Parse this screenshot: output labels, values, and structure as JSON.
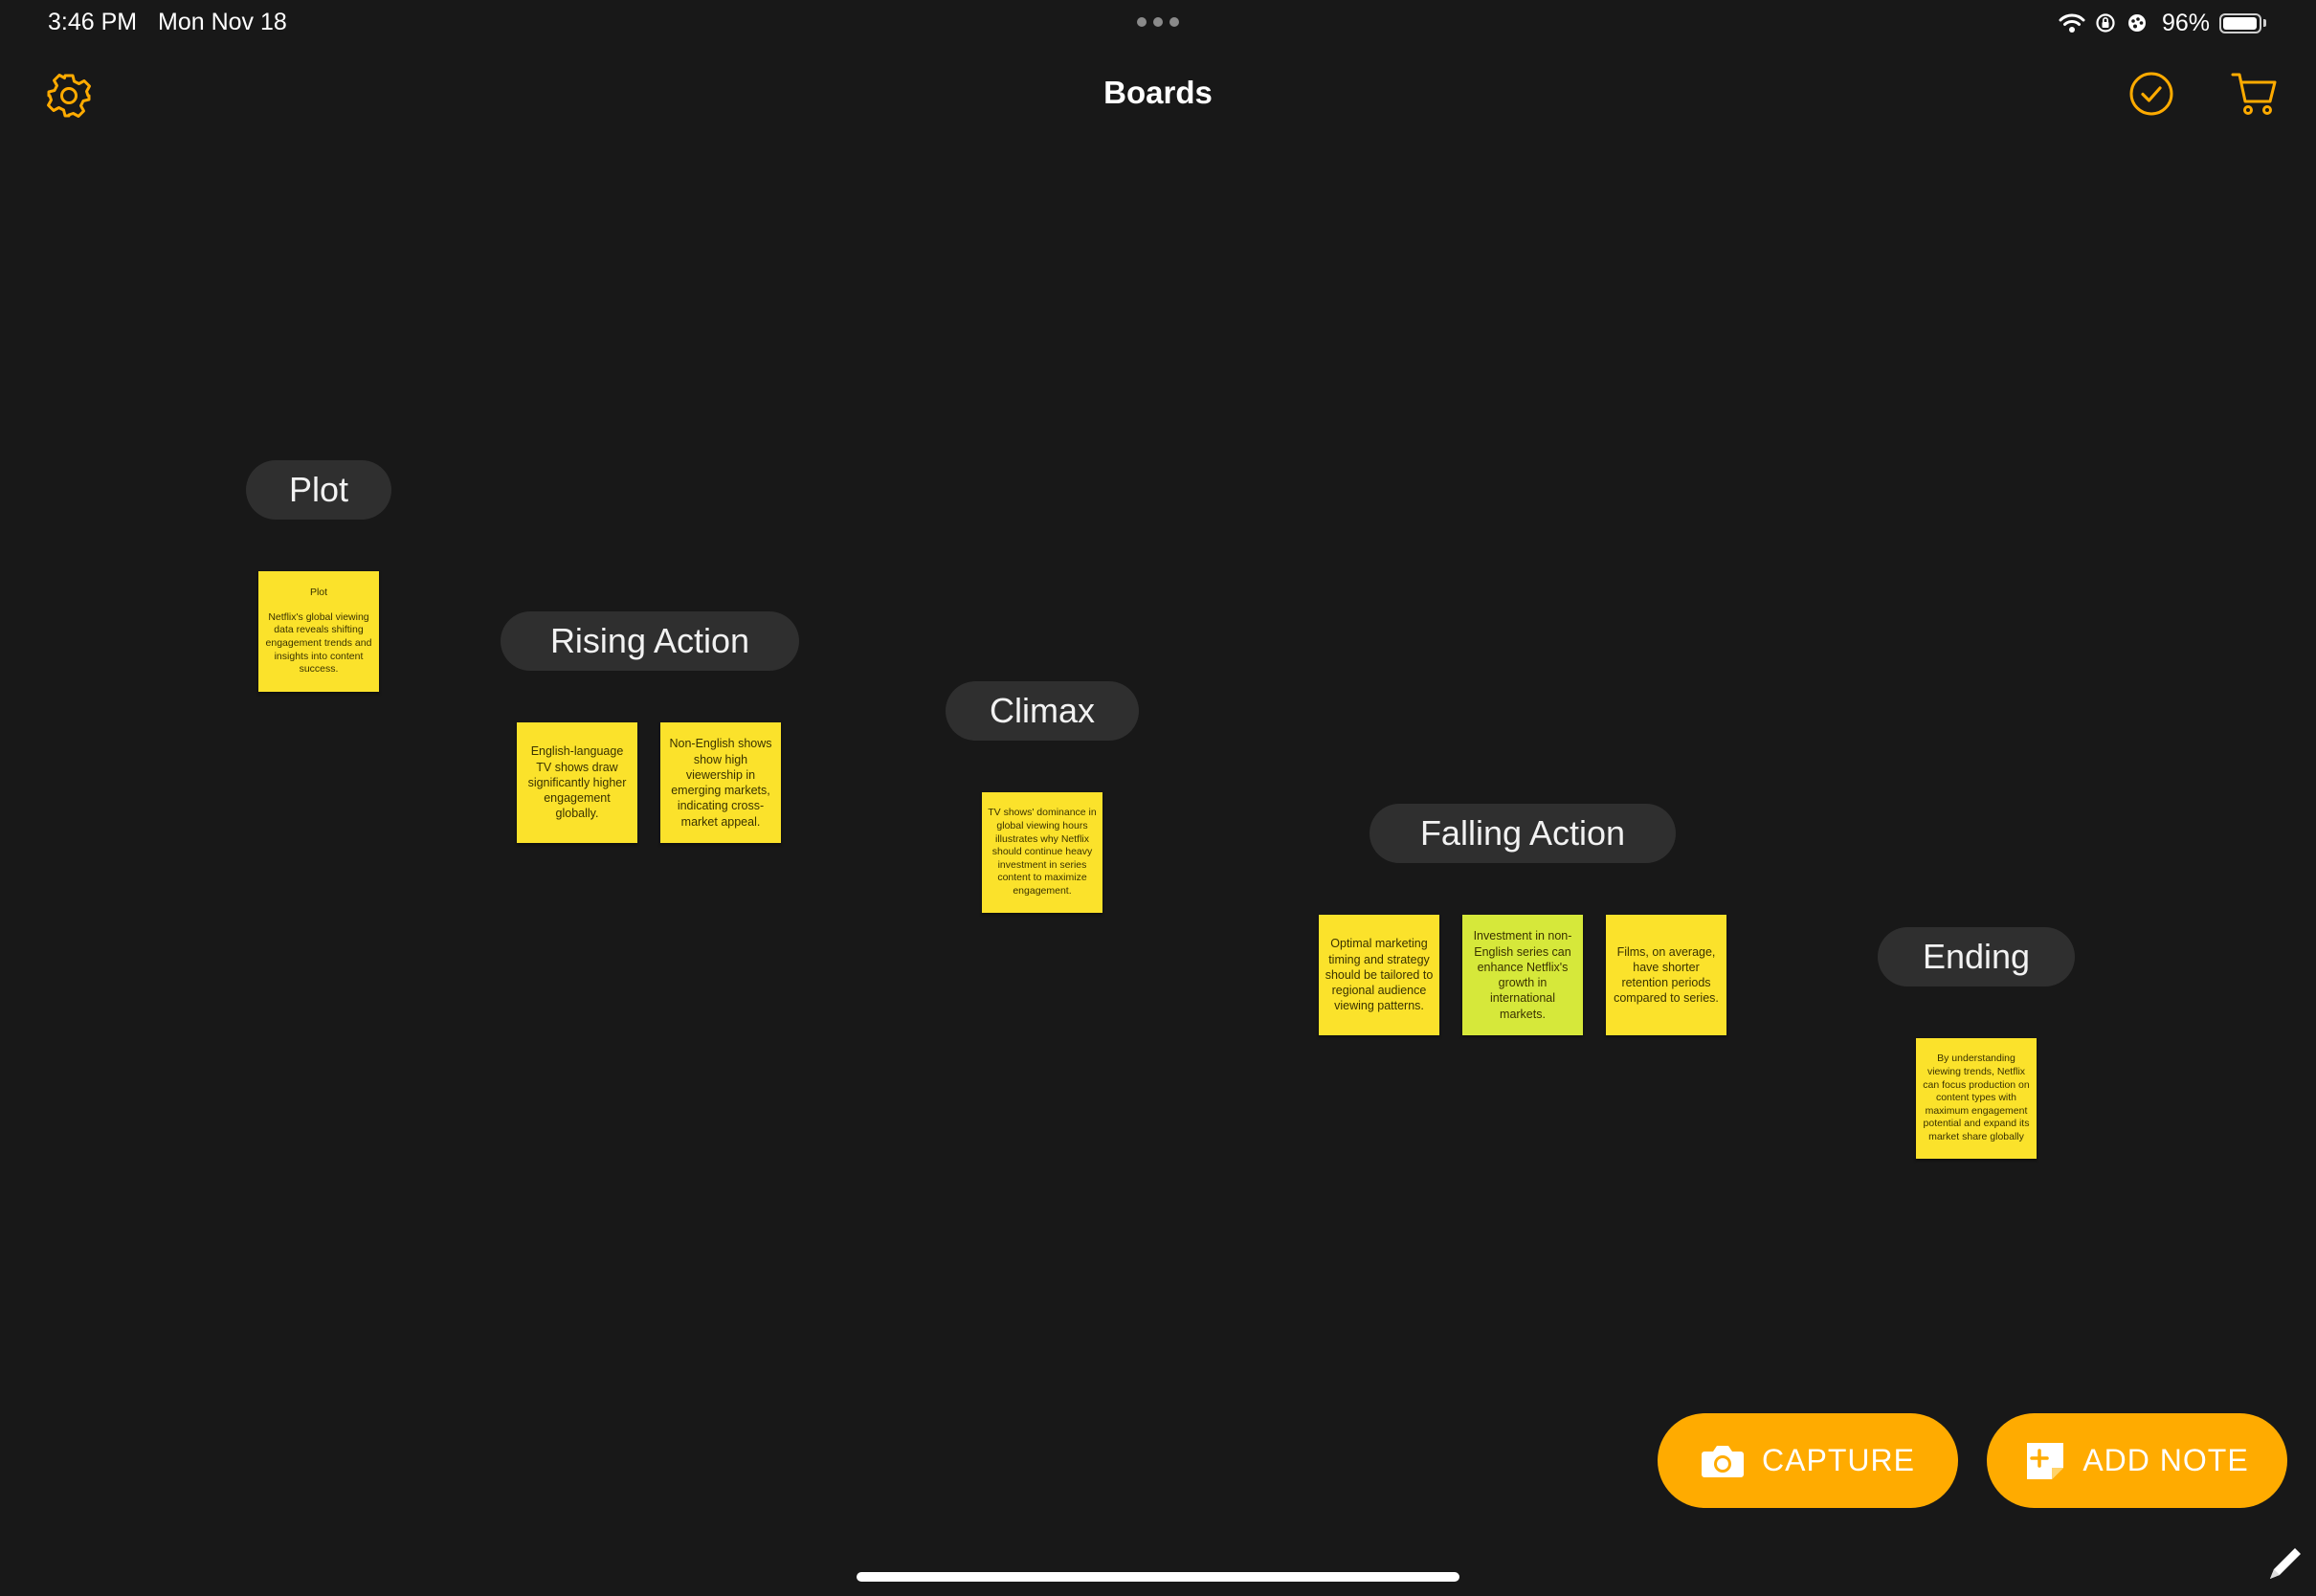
{
  "status_bar": {
    "time": "3:46 PM",
    "date": "Mon Nov 18",
    "battery_percent": "96%",
    "battery_level": 0.96,
    "icons": [
      "wifi-icon",
      "orientation-lock-icon",
      "focus-icon",
      "battery-icon"
    ]
  },
  "nav": {
    "title": "Boards",
    "left_icon": "gear-icon",
    "right_icons": [
      "checkmark-circle-icon",
      "cart-icon"
    ]
  },
  "accent_color": "#ffab00",
  "note_color": "#fbe22b",
  "note_color_alt": "#d6e83a",
  "sections": [
    {
      "label": "Plot",
      "notes": [
        {
          "title": "Plot",
          "text": "Netflix's global viewing data reveals shifting engagement trends and insights into content success."
        }
      ]
    },
    {
      "label": "Rising Action",
      "notes": [
        {
          "text": "English-language TV shows draw significantly higher engagement globally."
        },
        {
          "text": "Non-English shows show high viewership in emerging markets, indicating cross-market appeal."
        }
      ]
    },
    {
      "label": "Climax",
      "notes": [
        {
          "text": "TV shows' dominance in global viewing hours illustrates why Netflix should continue heavy investment in series content to maximize engagement."
        }
      ]
    },
    {
      "label": "Falling Action",
      "notes": [
        {
          "text": "Optimal marketing timing and strategy should be tailored to regional audience viewing patterns."
        },
        {
          "text": "Investment in non-English series can enhance Netflix's growth in international markets."
        },
        {
          "text": "Films, on average, have shorter retention periods compared to series."
        }
      ]
    },
    {
      "label": "Ending",
      "notes": [
        {
          "text": "By understanding viewing trends, Netflix can focus production on content types with maximum engagement potential and expand its market share globally"
        }
      ]
    }
  ],
  "buttons": {
    "capture": {
      "label": "CAPTURE",
      "icon": "camera-icon"
    },
    "add_note": {
      "label": "ADD NOTE",
      "icon": "add-note-icon"
    }
  },
  "bottom_right_icon": "pencil-icon"
}
